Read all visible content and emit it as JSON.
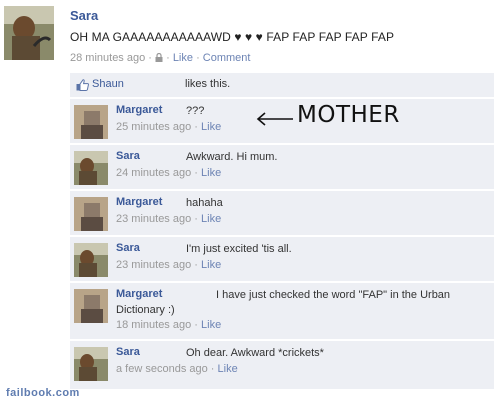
{
  "post": {
    "author": "Sara",
    "status": "OH MA GAAAAAAAAAAAWD ♥ ♥ ♥ FAP FAP FAP FAP FAP",
    "time": "28 minutes ago",
    "privacy_icon": "lock-icon",
    "sep": "·",
    "like_label": "Like",
    "comment_label": "Comment"
  },
  "likes": {
    "icon": "thumbs-up-icon",
    "who": "Shaun",
    "text": "likes this."
  },
  "comments": [
    {
      "author": "Margaret",
      "text": "???",
      "time": "25 minutes ago",
      "like": "Like"
    },
    {
      "author": "Sara",
      "text": "Awkward. Hi mum.",
      "time": "24 minutes ago",
      "like": "Like"
    },
    {
      "author": "Margaret",
      "text": "hahaha",
      "time": "23 minutes ago",
      "like": "Like"
    },
    {
      "author": "Sara",
      "text": "I'm just excited 'tis all.",
      "time": "23 minutes ago",
      "like": "Like"
    },
    {
      "author": "Margaret",
      "text": "I have just checked the word \"FAP\" in the Urban Dictionary :)",
      "time": "18 minutes ago",
      "like": "Like"
    },
    {
      "author": "Sara",
      "text": "Oh dear. Awkward *crickets*",
      "time": "a few seconds ago",
      "like": "Like"
    }
  ],
  "annotation": "MOTHER",
  "watermark": "failbook.com",
  "colors": {
    "link": "#3b5998",
    "comment_bg": "#edeff4",
    "meta": "#999999"
  }
}
